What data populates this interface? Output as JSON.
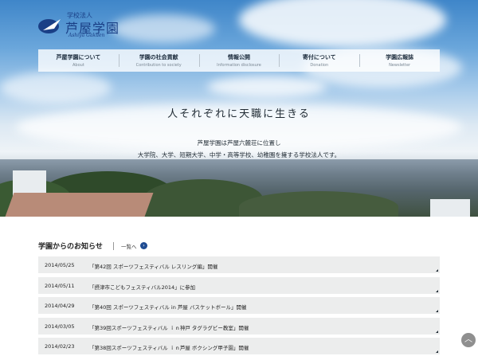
{
  "header": {
    "logo_small": "学校法人",
    "logo_main": "芦屋学園",
    "logo_en": "Ashiya Gakuen"
  },
  "nav": {
    "items": [
      {
        "jp": "芦屋学園について",
        "en": "About"
      },
      {
        "jp": "学園の社会貢献",
        "en": "Contribution to society"
      },
      {
        "jp": "情報公開",
        "en": "Information disclosure"
      },
      {
        "jp": "寄付について",
        "en": "Donation"
      },
      {
        "jp": "学園広報誌",
        "en": "Newsletter"
      }
    ]
  },
  "hero": {
    "tagline": "人それぞれに天職に生きる",
    "desc_line1": "芦屋学園は芦屋六麓荘に位置し",
    "desc_line2": "大学院、大学、短期大学、中学・高等学校、幼稚園を擁する学校法人です。"
  },
  "news": {
    "title": "学園からのお知らせ",
    "more_label": "一覧へ",
    "items": [
      {
        "date": "2014/05/25",
        "text": "「第42回 スポーツフェスティバル レスリング編」開催"
      },
      {
        "date": "2014/05/11",
        "text": "「摂津市こどもフェスティバル2014」に参加"
      },
      {
        "date": "2014/04/29",
        "text": "「第40回 スポーツフェスティバル in 芦屋 バスケットボール」開催"
      },
      {
        "date": "2014/03/05",
        "text": "「第39回スポーツフェスティバル ｉｎ神戸 タグラグビー教室」開催"
      },
      {
        "date": "2014/02/23",
        "text": "「第38回スポーツフェスティバル ｉｎ芦屋 ボクシング甲子園」開催"
      }
    ]
  },
  "icons": {
    "more": "chevron-right-circle-icon",
    "pagetop": "chevron-up-icon"
  },
  "colors": {
    "brand": "#1a3f86",
    "row_bg": "#eceded"
  }
}
